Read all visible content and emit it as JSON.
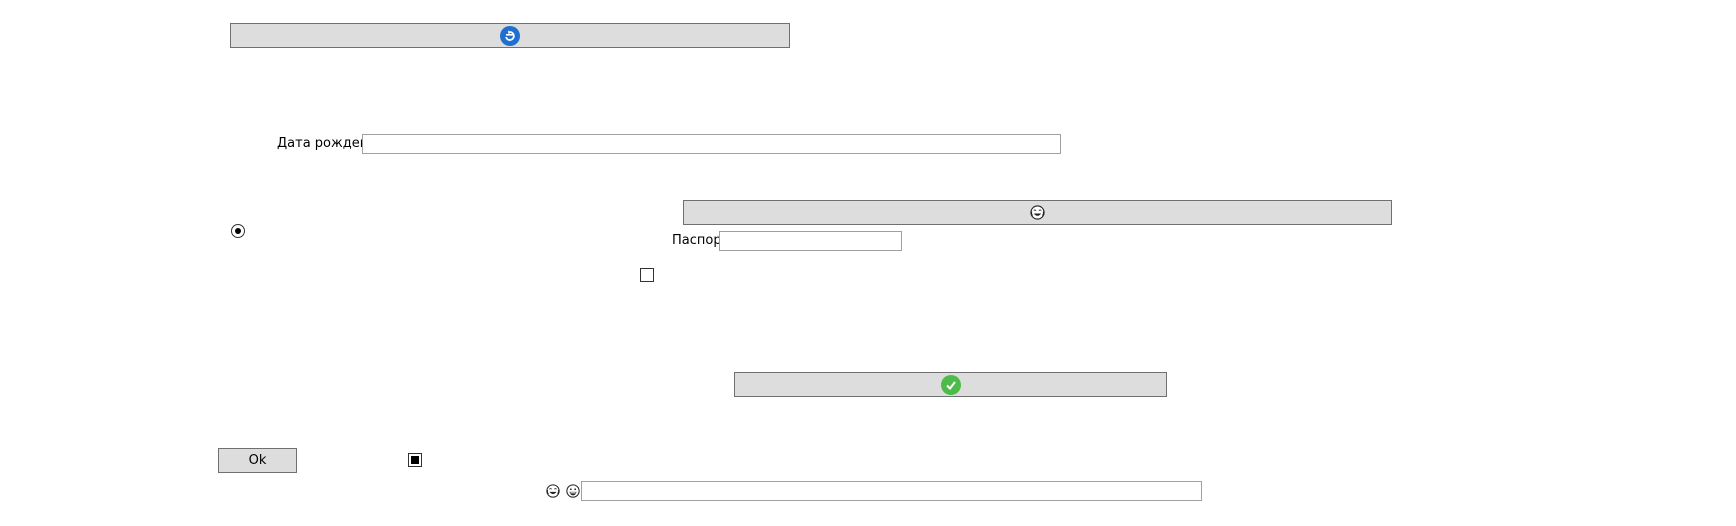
{
  "buttons": {
    "top": {
      "icon": "circular-arrow-icon",
      "icon_color": "#1e6fd0"
    },
    "middle": {
      "icon": "crying-laughing-face-icon"
    },
    "bottom": {
      "icon": "check-icon",
      "icon_color": "#4cbb47"
    },
    "ok": {
      "label": "Ok"
    }
  },
  "form": {
    "birth_date": {
      "label": "Дата рождения",
      "value": ""
    },
    "passport": {
      "label": "Паспорт",
      "value": ""
    },
    "bottom_input": {
      "value": ""
    }
  },
  "controls": {
    "radio_selected": true,
    "checkbox_unchecked": false,
    "checkbox_indeterminate": true
  },
  "emoji_row": [
    "crying-laughing-face-icon",
    "grinning-face-icon"
  ],
  "colors": {
    "button_bg": "#dddddd",
    "button_border": "#707070",
    "input_border": "#a0a0a0"
  }
}
